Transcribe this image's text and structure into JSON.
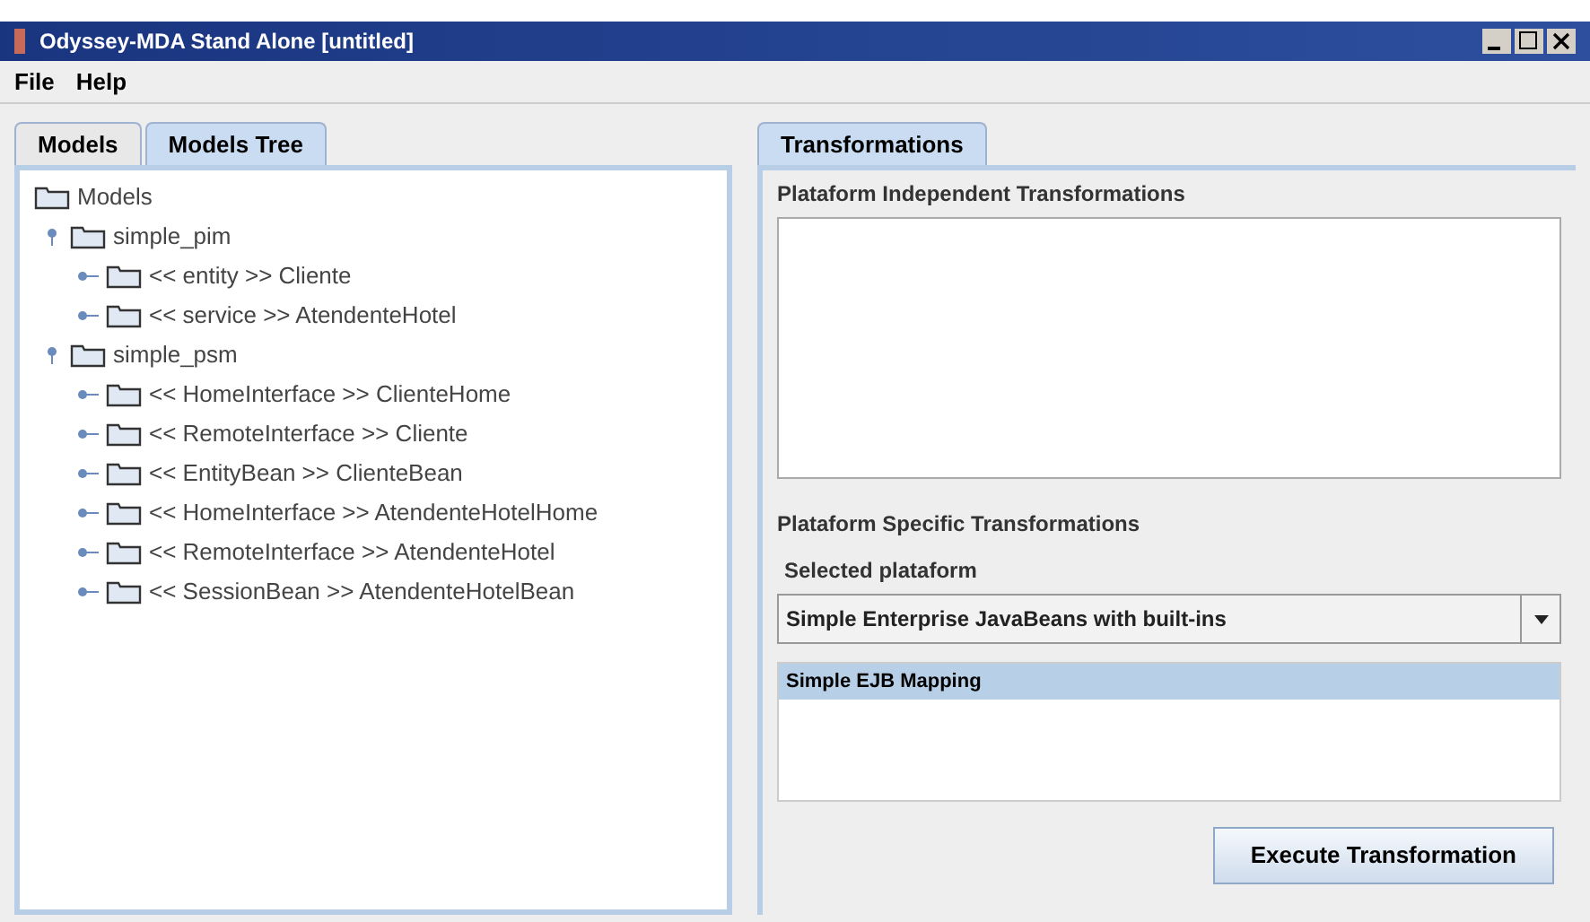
{
  "window": {
    "title": "Odyssey-MDA Stand Alone [untitled]"
  },
  "menu": [
    "File",
    "Help"
  ],
  "left_tabs": [
    {
      "label": "Models",
      "selected": false
    },
    {
      "label": "Models Tree",
      "selected": true
    }
  ],
  "tree": {
    "label": "Models",
    "children": [
      {
        "label": "simple_pim",
        "expanded": true,
        "children": [
          {
            "label": "<< entity >> Cliente",
            "expanded": false
          },
          {
            "label": "<< service >> AtendenteHotel",
            "expanded": false
          }
        ]
      },
      {
        "label": "simple_psm",
        "expanded": true,
        "children": [
          {
            "label": "<< HomeInterface >> ClienteHome",
            "expanded": false
          },
          {
            "label": "<< RemoteInterface >> Cliente",
            "expanded": false
          },
          {
            "label": "<< EntityBean >> ClienteBean",
            "expanded": false
          },
          {
            "label": "<< HomeInterface >> AtendenteHotelHome",
            "expanded": false
          },
          {
            "label": "<< RemoteInterface >> AtendenteHotel",
            "expanded": false
          },
          {
            "label": "<< SessionBean >> AtendenteHotelBean",
            "expanded": false
          }
        ]
      }
    ]
  },
  "right_tabs": [
    {
      "label": "Transformations",
      "selected": true
    }
  ],
  "independent": {
    "title": "Plataform Independent Transformations"
  },
  "specific": {
    "title": "Plataform Specific Transformations",
    "platform_label": "Selected plataform",
    "platform_value": "Simple Enterprise JavaBeans with built-ins",
    "mappings": [
      {
        "label": "Simple EJB Mapping",
        "selected": true
      }
    ]
  },
  "execute_button": "Execute Transformation"
}
